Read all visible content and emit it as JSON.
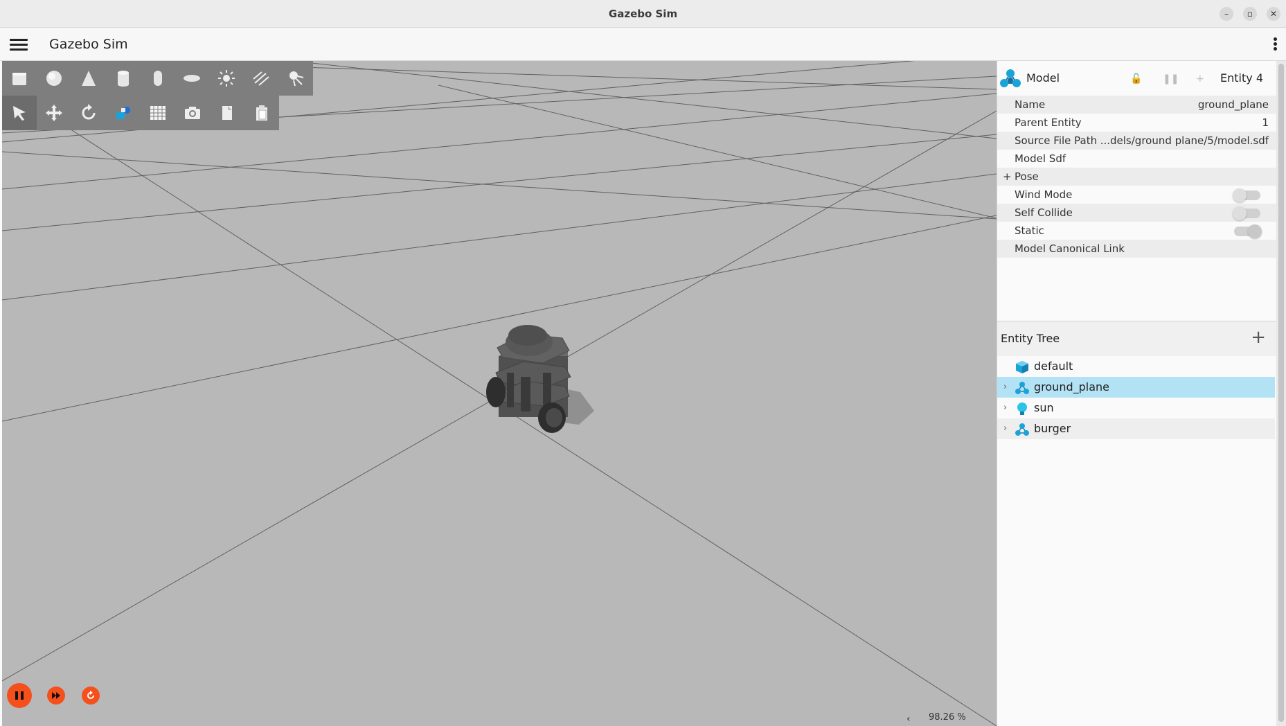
{
  "window": {
    "title": "Gazebo Sim",
    "controls": [
      "minimize-icon",
      "restore-icon",
      "close-icon"
    ]
  },
  "toolbar": {
    "menu_icon": "hamburger-menu-icon",
    "app_title": "Gazebo Sim",
    "more_icon": "kebab-menu-icon"
  },
  "shapes_toolbar": [
    "box-icon",
    "sphere-icon",
    "cone-icon",
    "cylinder-icon",
    "capsule-icon",
    "ellipsoid-icon",
    "directional-light-icon",
    "point-light-icon",
    "spot-light-icon"
  ],
  "transform_toolbar": [
    "select-arrow-icon",
    "translate-icon",
    "rotate-icon",
    "view-angle-icon",
    "grid-icon",
    "camera-icon",
    "copy-icon",
    "paste-icon"
  ],
  "playback": [
    "pause-icon",
    "step-forward-icon",
    "reset-icon"
  ],
  "status": {
    "real_time_factor": "98.26 %"
  },
  "component_inspector": {
    "title": "Model",
    "entity": "Entity 4",
    "header_icons": [
      "lock-icon",
      "pause-icon",
      "plus-icon"
    ],
    "properties": [
      {
        "key": "Name",
        "value": "ground_plane"
      },
      {
        "key": "Parent Entity",
        "value": "1"
      },
      {
        "key": "Source File Path",
        "value": "...dels/ground plane/5/model.sdf"
      },
      {
        "key": "Model Sdf",
        "value": ""
      },
      {
        "key": "Pose",
        "value": "",
        "expand": "+"
      },
      {
        "key": "Wind Mode",
        "toggle": false
      },
      {
        "key": "Self Collide",
        "toggle": false
      },
      {
        "key": "Static",
        "toggle": true
      },
      {
        "key": "Model Canonical Link",
        "value": ""
      }
    ]
  },
  "entity_tree": {
    "title": "Entity Tree",
    "add_label": "+",
    "items": [
      {
        "label": "default",
        "icon": "world-cube-icon",
        "expandable": false
      },
      {
        "label": "ground_plane",
        "icon": "model-icon",
        "expandable": true,
        "selected": true
      },
      {
        "label": "sun",
        "icon": "light-bulb-icon",
        "expandable": true
      },
      {
        "label": "burger",
        "icon": "model-icon",
        "expandable": true
      }
    ]
  },
  "colors": {
    "accent_orange": "#f5501c",
    "selection_blue": "#b3e2f5",
    "viewport_gray": "#b8b8b8",
    "toolbar_gray": "#7e7e7e",
    "icon_blue": "#1aa3d9"
  }
}
